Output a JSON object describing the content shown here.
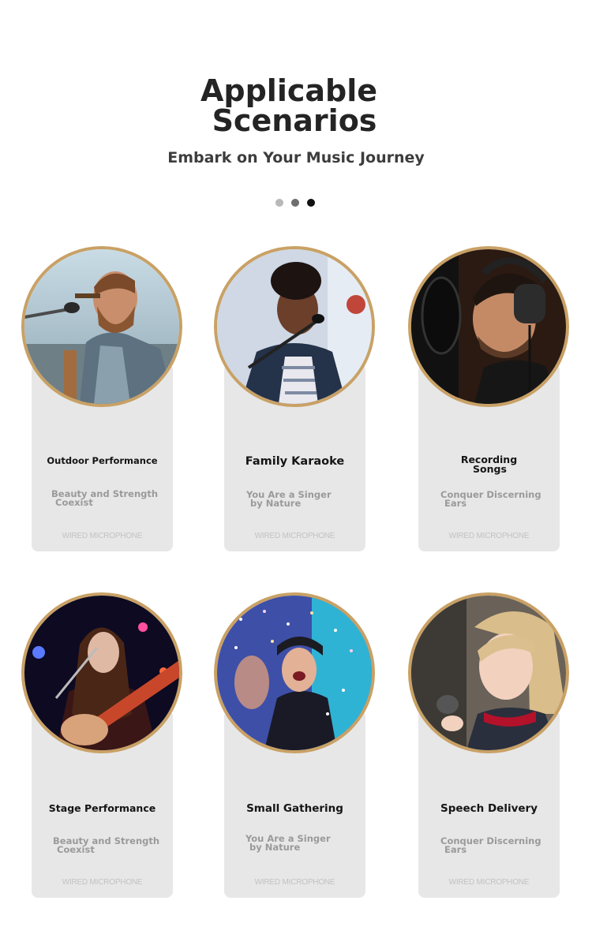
{
  "header": {
    "title_line1": "Applicable",
    "title_line2": "Scenarios",
    "subtitle": "Embark on Your Music Journey",
    "dots": [
      {
        "color": "#b8b8b8"
      },
      {
        "color": "#6e6e6e"
      },
      {
        "color": "#111111"
      }
    ]
  },
  "accent_color": "#c9a165",
  "card_background": "#e7e7e7",
  "cards": [
    {
      "title": "Outdoor Performance",
      "subtitle_line1": "Beauty and Strength",
      "subtitle_line2": "Coexist",
      "footer": "WIRED MICROPHONE",
      "photo": "man-singing-outdoors-photo"
    },
    {
      "title": "Family Karaoke",
      "subtitle_line1": "You Are a Singer",
      "subtitle_line2": "by Nature",
      "footer": "WIRED MICROPHONE",
      "photo": "woman-singing-microphone-photo"
    },
    {
      "title_line1": "Recording",
      "title_line2": "Songs",
      "subtitle_line1": "Conquer Discerning",
      "subtitle_line2": "Ears",
      "footer": "WIRED MICROPHONE",
      "photo": "man-recording-headphones-photo"
    },
    {
      "title": "Stage Performance",
      "subtitle_line1": "Beauty and Strength",
      "subtitle_line2": "Coexist",
      "footer": "WIRED MICROPHONE",
      "photo": "woman-guitar-stage-photo"
    },
    {
      "title": "Small Gathering",
      "subtitle_line1": "You Are a Singer",
      "subtitle_line2": "by Nature",
      "footer": "WIRED MICROPHONE",
      "photo": "party-confetti-photo"
    },
    {
      "title": "Speech Delivery",
      "subtitle_line1": "Conquer Discerning",
      "subtitle_line2": "Ears",
      "footer": "WIRED MICROPHONE",
      "photo": "child-microphone-photo"
    }
  ]
}
